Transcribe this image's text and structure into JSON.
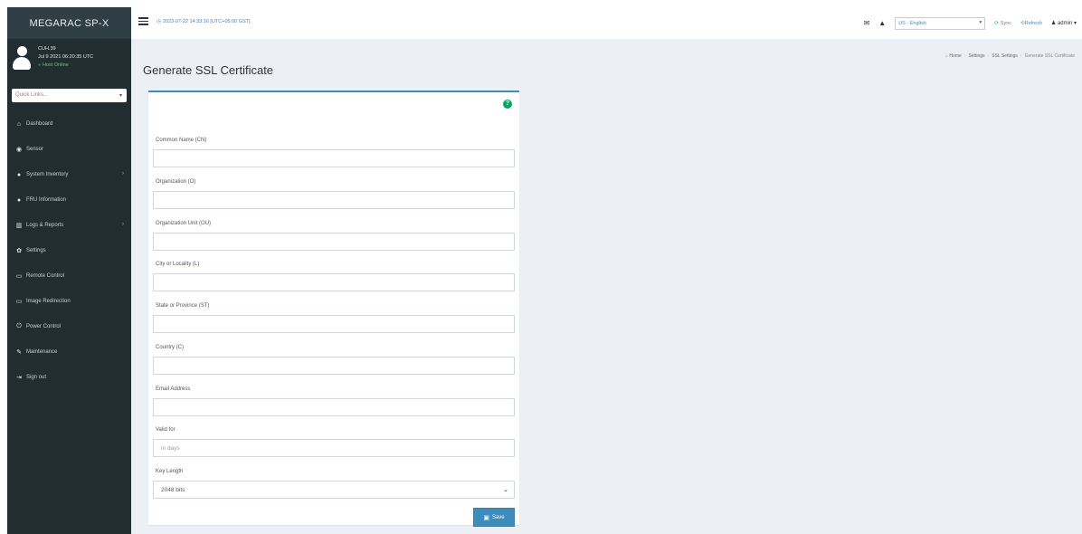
{
  "brand": "MEGARAC SP-X",
  "user": {
    "name": "CUH.39",
    "datetime": "Jul 9 2021 06:20:35 UTC",
    "status": "Host Online"
  },
  "quicklinks": {
    "placeholder": "Quick Links..."
  },
  "menu": [
    {
      "label": "Dashboard",
      "icon": "dashboard-icon",
      "glyph": "⌂"
    },
    {
      "label": "Sensor",
      "icon": "sensor-icon",
      "glyph": "◉"
    },
    {
      "label": "System Inventory",
      "icon": "inventory-icon",
      "glyph": "●",
      "has_submenu": true
    },
    {
      "label": "FRU Information",
      "icon": "info-icon",
      "glyph": "●"
    },
    {
      "label": "Logs & Reports",
      "icon": "chart-icon",
      "glyph": "▥",
      "has_submenu": true
    },
    {
      "label": "Settings",
      "icon": "gear-icon",
      "glyph": "✿"
    },
    {
      "label": "Remote Control",
      "icon": "monitor-icon",
      "glyph": "▭"
    },
    {
      "label": "Image Redirection",
      "icon": "disk-icon",
      "glyph": "▭"
    },
    {
      "label": "Power Control",
      "icon": "power-icon",
      "glyph": "⏻"
    },
    {
      "label": "Maintenance",
      "icon": "wrench-icon",
      "glyph": "✎"
    },
    {
      "label": "Sign out",
      "icon": "signout-icon",
      "glyph": "⇥"
    }
  ],
  "topbar": {
    "datetime": "2023-07-22 14:33:16 [UTC+05:00 GST]",
    "language": "US - English",
    "sync_label": "Sync",
    "refresh_label": "Refresh",
    "admin_label": "admin"
  },
  "page": {
    "title": "Generate SSL Certificate",
    "breadcrumb": [
      "Home",
      "Settings",
      "SSL Settings",
      "Generate SSL Certificate"
    ]
  },
  "form": {
    "fields": [
      {
        "label": "Common Name (CN)",
        "value": ""
      },
      {
        "label": "Organization (O)",
        "value": ""
      },
      {
        "label": "Organization Unit (OU)",
        "value": ""
      },
      {
        "label": "City or Locality (L)",
        "value": ""
      },
      {
        "label": "State or Province (ST)",
        "value": ""
      },
      {
        "label": "Country (C)",
        "value": ""
      },
      {
        "label": "Email Address",
        "value": ""
      },
      {
        "label": "Valid for",
        "placeholder": "in days"
      }
    ],
    "key_length": {
      "label": "Key Length",
      "value": "2048 bits"
    },
    "save_label": "Save"
  },
  "colors": {
    "sidebar": "#222d32",
    "accent": "#3c8dbc",
    "success": "#00a65a"
  }
}
